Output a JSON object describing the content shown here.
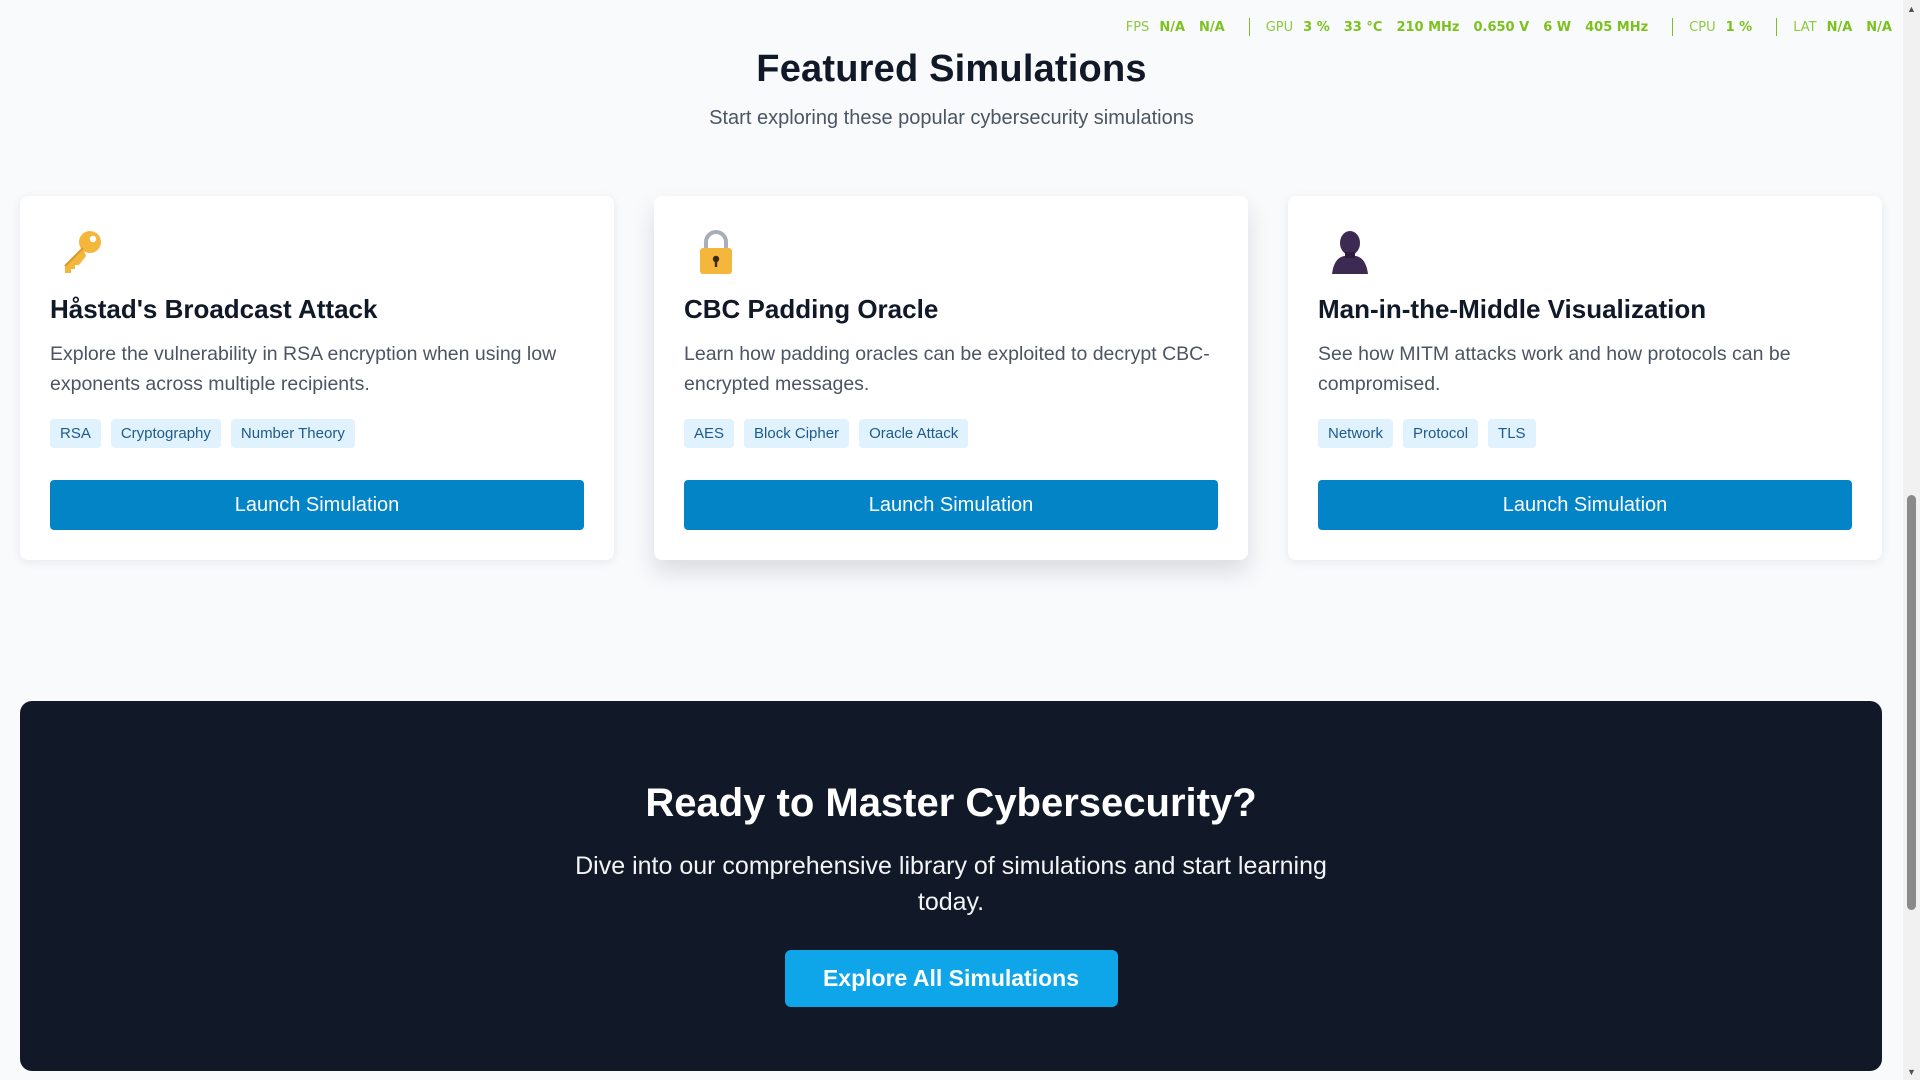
{
  "overlay": {
    "fps_label": "FPS",
    "fps_values": [
      "N/A",
      "N/A"
    ],
    "gpu_label": "GPU",
    "gpu_values": [
      "3 %",
      "33 °C",
      "210 MHz",
      "0.650 V",
      "6 W",
      "405 MHz"
    ],
    "cpu_label": "CPU",
    "cpu_value": "1 %",
    "lat_label": "LAT",
    "lat_values": [
      "N/A",
      "N/A"
    ]
  },
  "featured": {
    "title": "Featured Simulations",
    "subtitle": "Start exploring these popular cybersecurity simulations"
  },
  "cards": [
    {
      "icon": "key-icon",
      "title": "Håstad's Broadcast Attack",
      "description": "Explore the vulnerability in RSA encryption when using low exponents across multiple recipients.",
      "tags": [
        "RSA",
        "Cryptography",
        "Number Theory"
      ],
      "button": "Launch Simulation"
    },
    {
      "icon": "lock-icon",
      "title": "CBC Padding Oracle",
      "description": "Learn how padding oracles can be exploited to decrypt CBC-encrypted messages.",
      "tags": [
        "AES",
        "Block Cipher",
        "Oracle Attack"
      ],
      "button": "Launch Simulation"
    },
    {
      "icon": "person-silhouette-icon",
      "title": "Man-in-the-Middle Visualization",
      "description": "See how MITM attacks work and how protocols can be compromised.",
      "tags": [
        "Network",
        "Protocol",
        "TLS"
      ],
      "button": "Launch Simulation"
    }
  ],
  "cta": {
    "title": "Ready to Master Cybersecurity?",
    "text": "Dive into our comprehensive library of simulations and start learning today.",
    "button": "Explore All Simulations"
  },
  "colors": {
    "accent": "#0284c7",
    "cta_button": "#0ea5e9",
    "cta_background": "#111827",
    "tag_background": "#e0f2fe",
    "overlay_text": "#7cc11e"
  },
  "scrollbar": {
    "position_fraction": 0.62
  }
}
